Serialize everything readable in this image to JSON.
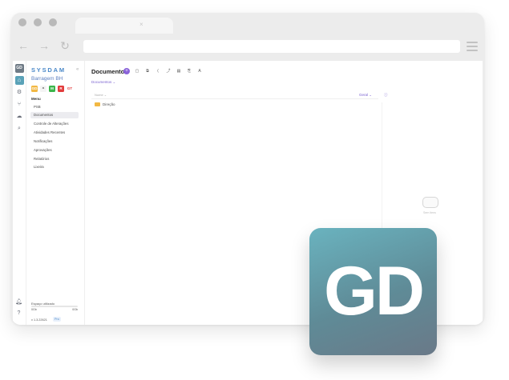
{
  "browser": {
    "tab_close": "×",
    "nav": {
      "back": "←",
      "forward": "→",
      "reload": "↻"
    }
  },
  "rail": {
    "logo": "GD",
    "icons": [
      "home-icon",
      "gear-icon",
      "branch-icon",
      "cloud-icon",
      "search-icon",
      "bell-icon",
      "help-icon"
    ],
    "help": "?",
    "bell_badge": "1"
  },
  "sidebar": {
    "brand": "SYSDAM",
    "collapse": "«",
    "project": "Barragem BH",
    "apps": [
      {
        "label": "GD",
        "color": "#f2b843"
      },
      {
        "label": "^",
        "color": "#f4f4f4"
      },
      {
        "label": "M",
        "color": "#3bb54a"
      },
      {
        "label": "R",
        "color": "#e23c3c"
      },
      {
        "label": "GT",
        "color": "#ffffff"
      }
    ],
    "section_label": "Menu",
    "items": [
      "PSB",
      "Documentos",
      "Controle de Alterações",
      "Atividades Recentes",
      "Notificações",
      "Aprovações",
      "Relatórios",
      "Lixeira"
    ],
    "active_index": 1,
    "storage_label": "Espaço utilizado",
    "storage_used": "0Gb",
    "storage_total": "0Gb",
    "version": "v 1.3.22621",
    "plan": "Pro"
  },
  "main": {
    "title": "Documentos",
    "add": "+",
    "toolbar": [
      "▢",
      "⧉",
      "⟨",
      "⤴",
      "▤",
      "⎘",
      "A"
    ],
    "breadcrumb": "Documentos ⌄",
    "column_header": "Nome ⌄",
    "filter": "Geral ⌄",
    "info": "ⓘ",
    "folders": [
      "Direção"
    ]
  },
  "details": {
    "empty_text": "Sem itens"
  },
  "overlay": {
    "logo_text": "GD"
  }
}
